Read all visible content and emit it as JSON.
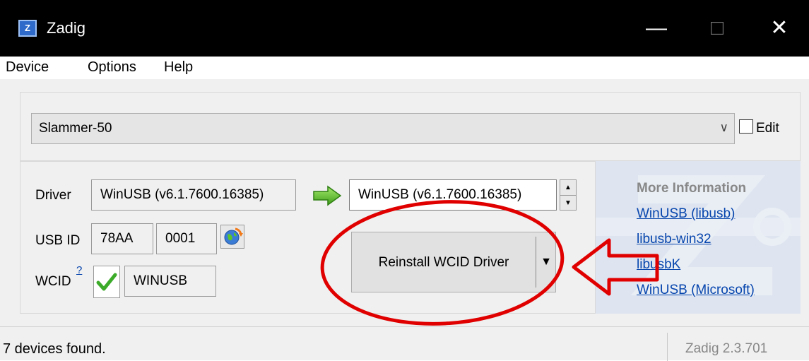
{
  "window": {
    "title": "Zadig",
    "app_icon_letter": "Z",
    "minimize_glyph": "—",
    "maximize_glyph": "□",
    "close_glyph": "✕"
  },
  "menu": {
    "items": [
      "Device",
      "Options",
      "Help"
    ]
  },
  "device_select": {
    "value": "Slammer-50",
    "edit_label": "Edit"
  },
  "driver": {
    "driver_label": "Driver",
    "current_driver": "WinUSB (v6.1.7600.16385)",
    "target_driver": "WinUSB (v6.1.7600.16385)",
    "usb_id_label": "USB ID",
    "vid": "78AA",
    "pid": "0001",
    "wcid_label": "WCID",
    "wcid_help": "?",
    "wcid_value": "WINUSB",
    "action_button": "Reinstall WCID Driver"
  },
  "info": {
    "heading": "More Information",
    "links": [
      "WinUSB (libusb)",
      "libusb-win32",
      "libusbK",
      "WinUSB (Microsoft)"
    ]
  },
  "status": {
    "text": "7 devices found.",
    "version": "Zadig 2.3.701"
  },
  "colors": {
    "annotation": "#e00000",
    "arrow_green": "#5cc42b",
    "link": "#0645ad"
  }
}
